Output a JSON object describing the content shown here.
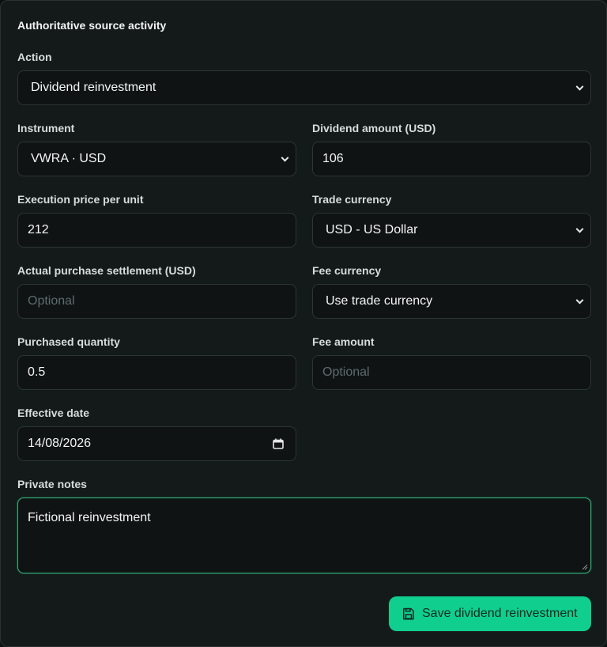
{
  "form": {
    "title": "Authoritative source activity",
    "action": {
      "label": "Action",
      "value": "Dividend reinvestment"
    },
    "instrument": {
      "label": "Instrument",
      "value": "VWRA · USD"
    },
    "dividend_amount": {
      "label": "Dividend amount (USD)",
      "value": "106"
    },
    "execution_price": {
      "label": "Execution price per unit",
      "value": "212"
    },
    "trade_currency": {
      "label": "Trade currency",
      "value": "USD - US Dollar"
    },
    "settlement": {
      "label": "Actual purchase settlement (USD)",
      "placeholder": "Optional"
    },
    "fee_currency": {
      "label": "Fee currency",
      "value": "Use trade currency"
    },
    "quantity": {
      "label": "Purchased quantity",
      "value": "0.5"
    },
    "fee_amount": {
      "label": "Fee amount",
      "placeholder": "Optional"
    },
    "effective_date": {
      "label": "Effective date",
      "value": "14/08/2026"
    },
    "notes": {
      "label": "Private notes",
      "value": "Fictional reinvestment"
    },
    "save_label": "Save dividend reinvestment"
  },
  "icons": {
    "save": "floppy-disk-icon",
    "calendar": "calendar-icon",
    "dropdown": "chevron-down-icon"
  },
  "colors": {
    "accent": "#10cf8e",
    "background": "#141a1a",
    "focus_border": "#2fae7a"
  }
}
